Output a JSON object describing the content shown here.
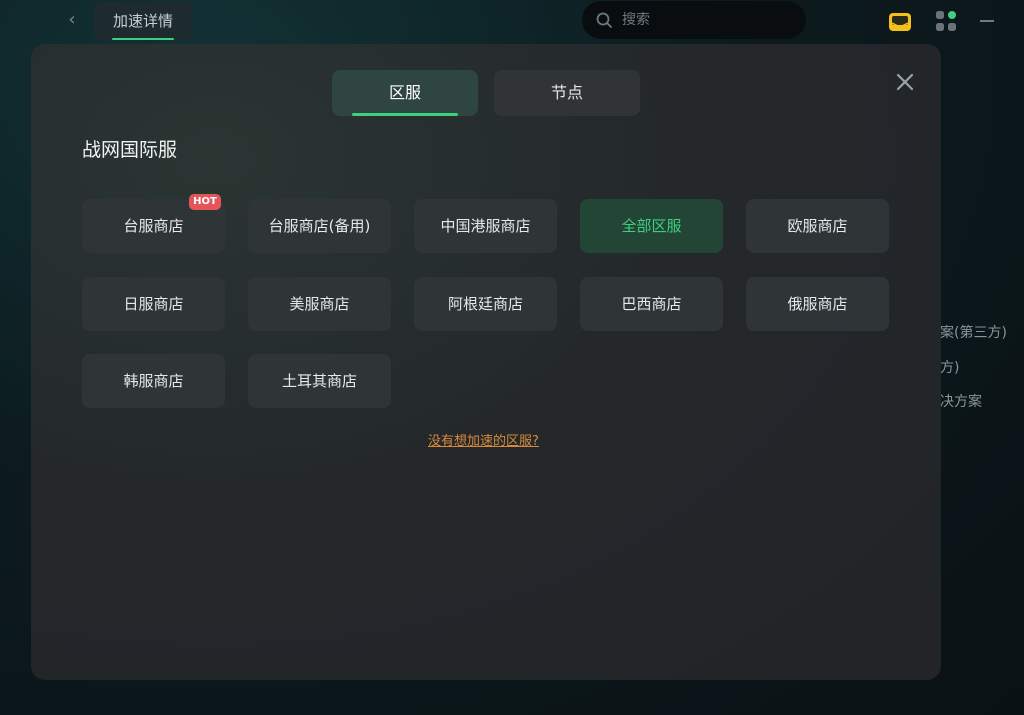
{
  "topbar": {
    "back_label": "‹",
    "page_title": "加速详情",
    "search_placeholder": "搜索"
  },
  "background_texts": [
    "案(第三方)",
    "方)",
    "决方案"
  ],
  "modal": {
    "tabs": [
      {
        "label": "区服",
        "active": true
      },
      {
        "label": "节点",
        "active": false
      }
    ],
    "section_title": "战网国际服",
    "servers": [
      {
        "label": "台服商店",
        "badge": "HOT"
      },
      {
        "label": "台服商店(备用)"
      },
      {
        "label": "中国港服商店"
      },
      {
        "label": "全部区服",
        "selected": true
      },
      {
        "label": "欧服商店"
      },
      {
        "label": "日服商店"
      },
      {
        "label": "美服商店"
      },
      {
        "label": "阿根廷商店"
      },
      {
        "label": "巴西商店"
      },
      {
        "label": "俄服商店"
      },
      {
        "label": "韩服商店"
      },
      {
        "label": "土耳其商店"
      }
    ],
    "missing_link": "没有想加速的区服?"
  },
  "colors": {
    "accent": "#3fcf7e",
    "hot_badge": "#e4555a",
    "link": "#d8893a",
    "modal_bg": "#232629"
  },
  "icons": [
    "back-icon",
    "search-icon",
    "mail-icon",
    "apps-icon",
    "minimize-icon",
    "close-icon"
  ]
}
